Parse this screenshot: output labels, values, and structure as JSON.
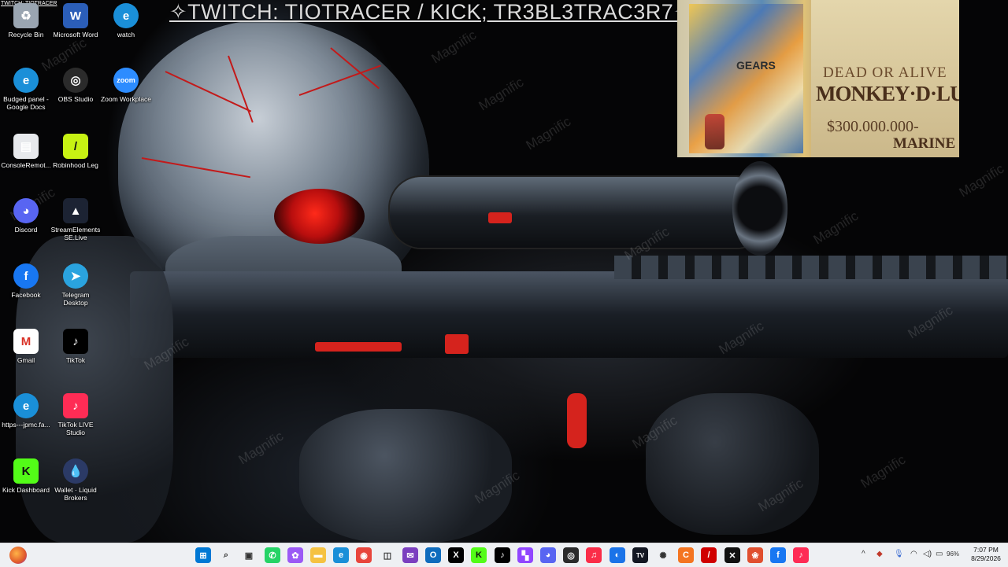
{
  "banner": {
    "text": "✧TWITCH: TIOTRACER / KICK; TR3BL3TRAC3R7✧",
    "corner_tag": "TWITCH: TIOTRACER"
  },
  "wallpaper": {
    "watermark_text": "Magnific",
    "accent_color": "#d5231d"
  },
  "overlay": {
    "poster_dead_or_alive": "DEAD OR ALIVE",
    "poster_name": "MONKEY·D·LUFFY",
    "poster_bounty": "$300.000.000-",
    "poster_marine": "MARINE",
    "sign_text": "GEARS"
  },
  "desktop_icons": [
    {
      "label": "Recycle Bin",
      "icon": "recycle-bin-icon",
      "color": "#9aa5b1"
    },
    {
      "label": "Microsoft Word",
      "icon": "word-icon",
      "color": "#2b5eb8"
    },
    {
      "label": "watch",
      "icon": "edge-icon",
      "color": "#1a8fd8"
    },
    {
      "label": "Budged panel - Google Docs",
      "icon": "edge-icon",
      "color": "#1a8fd8"
    },
    {
      "label": "OBS Studio",
      "icon": "obs-icon",
      "color": "#2b2b2b"
    },
    {
      "label": "Zoom Workplace",
      "icon": "zoom-icon",
      "color": "#2d8cff"
    },
    {
      "label": "ConsoleRemot...",
      "icon": "console-remote-icon",
      "color": "#e7e9ec"
    },
    {
      "label": "Robinhood Leg",
      "icon": "robinhood-icon",
      "color": "#c7f213"
    },
    {
      "label": "Discord",
      "icon": "discord-icon",
      "color": "#5865f2"
    },
    {
      "label": "StreamElements SE.Live",
      "icon": "streamelements-icon",
      "color": "#1c2333"
    },
    {
      "label": "Facebook",
      "icon": "facebook-icon",
      "color": "#1877f2"
    },
    {
      "label": "Telegram Desktop",
      "icon": "telegram-icon",
      "color": "#2aa3df"
    },
    {
      "label": "Gmail",
      "icon": "gmail-icon",
      "color": "#ffffff"
    },
    {
      "label": "TikTok",
      "icon": "tiktok-icon",
      "color": "#000000"
    },
    {
      "label": "https---jpmc.fa...",
      "icon": "edge-icon",
      "color": "#1a8fd8"
    },
    {
      "label": "TikTok LIVE Studio",
      "icon": "tiktok-live-icon",
      "color": "#fe2c55"
    },
    {
      "label": "Kick Dashboard",
      "icon": "kick-icon",
      "color": "#53fc18"
    },
    {
      "label": "Wallet · Liquid Brokers",
      "icon": "liquid-wallet-icon",
      "color": "#2b3a66"
    }
  ],
  "taskbar": {
    "apps": [
      {
        "name": "start-button",
        "glyph": "⊞",
        "bg": "#0078d4"
      },
      {
        "name": "search-button",
        "glyph": "⌕",
        "bg": "#eef0f3"
      },
      {
        "name": "task-view-button",
        "glyph": "▣",
        "bg": "#eef0f3"
      },
      {
        "name": "whatsapp-icon",
        "glyph": "✆",
        "bg": "#25d366"
      },
      {
        "name": "copilot-icon",
        "glyph": "✿",
        "bg": "#9b59f5"
      },
      {
        "name": "file-explorer-icon",
        "glyph": "▬",
        "bg": "#f5c242"
      },
      {
        "name": "edge-icon",
        "glyph": "e",
        "bg": "#1a8fd8"
      },
      {
        "name": "chrome-icon",
        "glyph": "◉",
        "bg": "#e8453c"
      },
      {
        "name": "store-icon",
        "glyph": "◫",
        "bg": "#eef0f3"
      },
      {
        "name": "mail-icon",
        "glyph": "✉",
        "bg": "#7b3fbf"
      },
      {
        "name": "outlook-icon",
        "glyph": "O",
        "bg": "#0f6cbd"
      },
      {
        "name": "x-icon",
        "glyph": "X",
        "bg": "#000000"
      },
      {
        "name": "kick-icon",
        "glyph": "K",
        "bg": "#53fc18"
      },
      {
        "name": "tiktok-icon",
        "glyph": "♪",
        "bg": "#000000"
      },
      {
        "name": "twitch-icon",
        "glyph": "▚",
        "bg": "#9146ff"
      },
      {
        "name": "discord-icon",
        "glyph": "◕",
        "bg": "#5865f2"
      },
      {
        "name": "obs-icon",
        "glyph": "◎",
        "bg": "#2b2b2b"
      },
      {
        "name": "apple-music-icon",
        "glyph": "♫",
        "bg": "#fa2d48"
      },
      {
        "name": "copilot-app-icon",
        "glyph": "◐",
        "bg": "#1a73e8"
      },
      {
        "name": "tradingview-icon",
        "glyph": "TV",
        "bg": "#131722"
      },
      {
        "name": "chatgpt-icon",
        "glyph": "✺",
        "bg": "#eef0f3"
      },
      {
        "name": "crunchyroll-icon",
        "glyph": "C",
        "bg": "#f47521"
      },
      {
        "name": "robinhood-icon",
        "glyph": "/",
        "bg": "#d00000"
      },
      {
        "name": "capcut-icon",
        "glyph": "✕",
        "bg": "#111111"
      },
      {
        "name": "photos-icon",
        "glyph": "❀",
        "bg": "#e04f2f"
      },
      {
        "name": "facebook-icon",
        "glyph": "f",
        "bg": "#1877f2"
      },
      {
        "name": "tiktok-live-icon",
        "glyph": "♪",
        "bg": "#fe2c55"
      }
    ],
    "tray": {
      "chevron": "^",
      "battery_percent": "96%",
      "time": "7:07 PM",
      "date": "8/29/2026"
    }
  }
}
